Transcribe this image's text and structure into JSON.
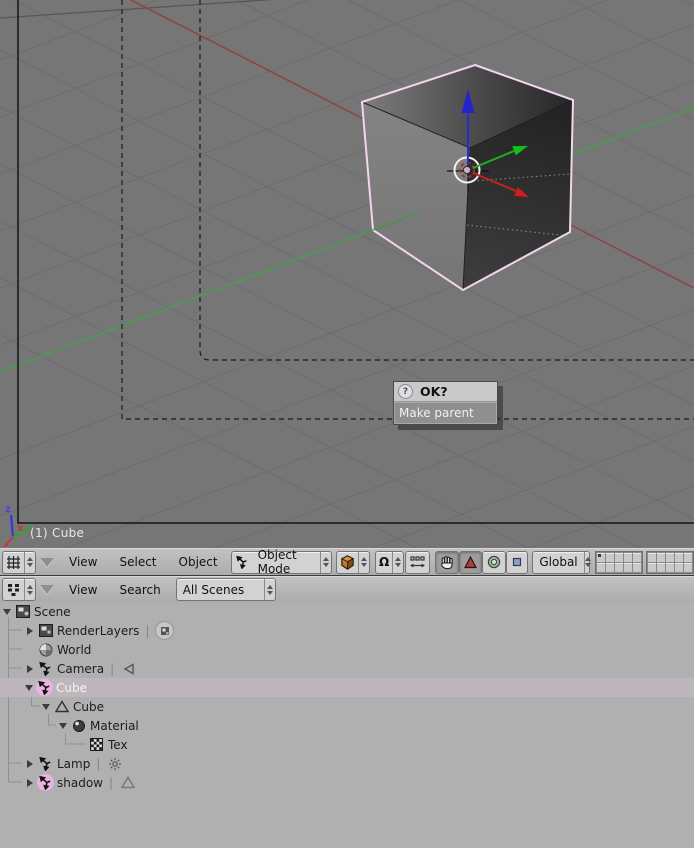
{
  "viewport": {
    "status_text": "(1) Cube",
    "axis_indicator": {
      "z_label": "z",
      "x_label": "x"
    },
    "popup": {
      "icon": "?",
      "title": "OK?",
      "item": "Make parent"
    }
  },
  "header_3d": {
    "menus": {
      "view": "View",
      "select": "Select",
      "object": "Object"
    },
    "mode_dropdown": "Object Mode",
    "pivot_symbol": "Ω",
    "orientation_dropdown": "Global"
  },
  "outliner_header": {
    "menus": {
      "view": "View",
      "search": "Search"
    },
    "scenes_dropdown": "All Scenes"
  },
  "outliner": {
    "separator": "|",
    "items": [
      {
        "label": "Scene"
      },
      {
        "label": "RenderLayers"
      },
      {
        "label": "World"
      },
      {
        "label": "Camera"
      },
      {
        "label": "Cube",
        "selected": true
      },
      {
        "label": "Cube"
      },
      {
        "label": "Material"
      },
      {
        "label": "Tex"
      },
      {
        "label": "Lamp"
      },
      {
        "label": "shadow",
        "selected": true
      }
    ]
  },
  "colors": {
    "viewport_bg": "#767676",
    "header_bg": "#b4b4b4",
    "selection_outline_pink": "#f0d6ee",
    "axis_green": "#47a047",
    "axis_red": "#8f4040",
    "gizmo_blue": "#2b2bd0",
    "gizmo_green": "#1db11d",
    "gizmo_red": "#cc2222",
    "object_icon_highlight": "#e9b4e2"
  }
}
